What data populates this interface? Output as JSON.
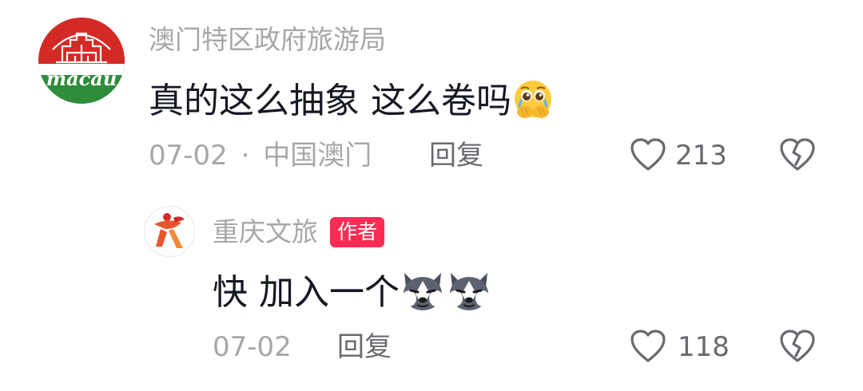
{
  "comments": [
    {
      "username": "澳门特区政府旅游局",
      "text": "真的这么抽象 这么卷吗",
      "emoji": "pleading-face-with-hands-emoji",
      "date": "07-02",
      "separator": "·",
      "location": "中国澳门",
      "reply_label": "回复",
      "like_count": "213",
      "avatar": {
        "text": "macau",
        "colors": {
          "top": "#d42a26",
          "bottom": "#2e8c3a"
        }
      }
    },
    {
      "username": "重庆文旅",
      "badge": "作者",
      "text": "快 加入一个",
      "emoji": "husky-dog-emoji",
      "emoji_count": 2,
      "date": "07-02",
      "reply_label": "回复",
      "like_count": "118"
    }
  ],
  "colors": {
    "badge": "#fe2c55",
    "username": "#a7a7a9",
    "text": "#161823",
    "icon": "#69696f"
  }
}
